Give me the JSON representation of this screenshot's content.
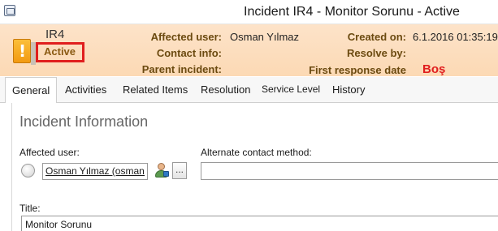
{
  "window": {
    "title": "Incident IR4 - Monitor Sorunu - Active"
  },
  "header": {
    "incident_id": "IR4",
    "status": "Active",
    "affected_user_label": "Affected user:",
    "affected_user_value": "Osman Yılmaz",
    "contact_info_label": "Contact info:",
    "parent_incident_label": "Parent incident:",
    "created_on_label": "Created on:",
    "created_on_value": "6.1.2016 01:35:19",
    "resolve_by_label": "Resolve by:",
    "first_response_label": "First response date",
    "annotation": "Boş"
  },
  "tabs": [
    "General",
    "Activities",
    "Related Items",
    "Resolution",
    "Service Level",
    "History"
  ],
  "active_tab": "General",
  "form": {
    "section_title": "Incident Information",
    "affected_user_label": "Affected user:",
    "affected_user_value": "Osman Yılmaz (osman.",
    "more_button": "...",
    "alternate_contact_label": "Alternate contact method:",
    "alternate_contact_value": "",
    "title_label": "Title:",
    "title_value": "Monitor Sorunu"
  },
  "colors": {
    "header_bg": "#fcd9b4",
    "status_highlight": "#e01e1e",
    "label_color": "#6b4a10"
  },
  "icons": [
    "window-app-icon",
    "alert-exclamation-icon",
    "user-picker-icon"
  ]
}
